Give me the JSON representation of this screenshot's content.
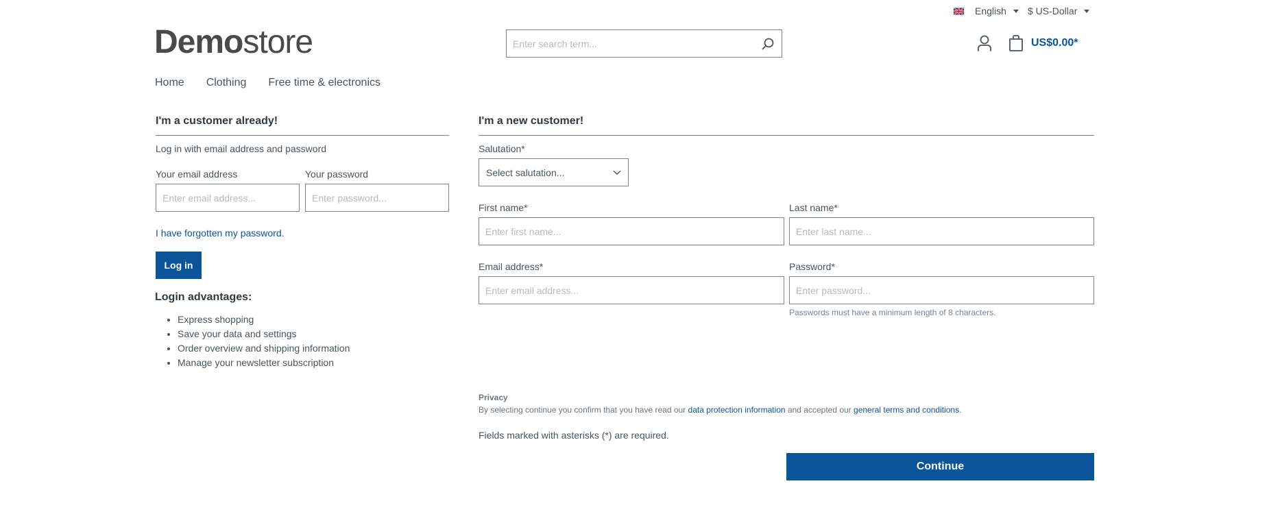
{
  "topbar": {
    "language": {
      "label": "English",
      "flag": "uk-flag"
    },
    "currency": {
      "label": "$ US-Dollar"
    }
  },
  "header": {
    "logo": {
      "bold": "Demo",
      "light": "store"
    },
    "search": {
      "placeholder": "Enter search term...",
      "value": ""
    },
    "account_icon": "user-icon",
    "cart": {
      "icon": "shopping-bag-icon",
      "price": "US$0.00*"
    }
  },
  "nav": {
    "items": [
      {
        "label": "Home"
      },
      {
        "label": "Clothing"
      },
      {
        "label": "Free time & electronics"
      }
    ]
  },
  "login": {
    "title": "I'm a customer already!",
    "subtitle": "Log in with email address and password",
    "email": {
      "label": "Your email address",
      "placeholder": "Enter email address...",
      "value": ""
    },
    "password": {
      "label": "Your password",
      "placeholder": "Enter password...",
      "value": ""
    },
    "forgot_link": "I have forgotten my password.",
    "submit_label": "Log in",
    "advantages": {
      "title": "Login advantages:",
      "items": [
        "Express shopping",
        "Save your data and settings",
        "Order overview and shipping information",
        "Manage your newsletter subscription"
      ]
    }
  },
  "register": {
    "title": "I'm a new customer!",
    "salutation": {
      "label": "Salutation*",
      "selected": "Select salutation..."
    },
    "first_name": {
      "label": "First name*",
      "placeholder": "Enter first name...",
      "value": ""
    },
    "last_name": {
      "label": "Last name*",
      "placeholder": "Enter last name...",
      "value": ""
    },
    "email": {
      "label": "Email address*",
      "placeholder": "Enter email address...",
      "value": ""
    },
    "password": {
      "label": "Password*",
      "placeholder": "Enter password...",
      "value": "",
      "hint": "Passwords must have a minimum length of 8 characters."
    },
    "privacy": {
      "title": "Privacy",
      "text_before": "By selecting continue you confirm that you have read our ",
      "link1": "data protection information",
      "text_middle": " and accepted our ",
      "link2": "general terms and conditions",
      "text_after": "."
    },
    "required_note": "Fields marked with asterisks (*) are required.",
    "submit_label": "Continue"
  },
  "colors": {
    "primary": "#0b539b",
    "text": "#4a545b",
    "border": "#798490"
  }
}
